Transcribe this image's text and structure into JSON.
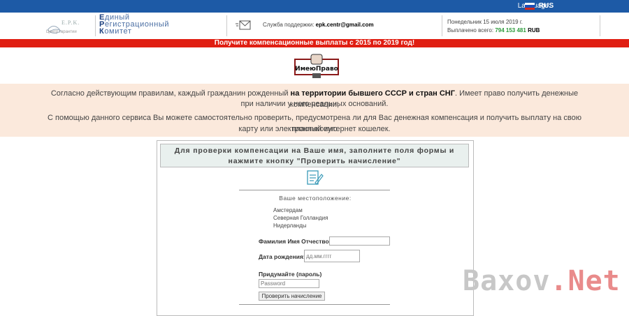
{
  "topbar": {
    "language_label": "Language:",
    "language_value": "RUS",
    "flag_colors": [
      "#ffffff",
      "#1d4fb8",
      "#d52b1e"
    ]
  },
  "header": {
    "logo_text": "E.P.K.",
    "logo_subtitle": "Центр гарантии",
    "org_name": {
      "line1_initial": "Е",
      "line1_rest": "диный",
      "line2_initial": "Р",
      "line2_rest": "егистрационный",
      "line3_initial": "К",
      "line3_rest": "омитет"
    },
    "support_label": "Служба поддержки:",
    "support_email": "epk.centr@gmail.com",
    "date_text": "Понедельник 15 июля 2019 г.",
    "paid_label": "Выплачено всего:",
    "paid_amount": "794 153 481",
    "paid_currency": "RUB"
  },
  "banner": {
    "text": "Получите компенсационные выплаты с 2015 по 2019 год!",
    "color": "#e01e12"
  },
  "emblem": {
    "text": "ИмеюПраво"
  },
  "info": {
    "p1_before": "Согласно действующим правилам, каждый гражданин рожденный ",
    "p1_bold": "на территории бывшего СССР и стран СНГ",
    "p1_after": ". Имеет право получить денежные компенсации,",
    "p1_line2": "при наличии у него реальных оснований.",
    "p2_line1": "С помощью данного сервиса Вы можете самостоятельно проверить, предусмотрена ли для Вас денежная компенсация и получить выплату на свою пластиковую",
    "p2_line2": "карту или электронный интернет кошелек."
  },
  "form": {
    "title_line1": "Для проверки компенсации на Ваше имя, заполните поля формы и",
    "title_line2": "нажмите кнопку \"Проверить начисление\"",
    "location_label": "Ваше местоположение:",
    "location_items": [
      "Амстердам",
      "Северная Голландия",
      "Нидерланды"
    ],
    "name_label": "Фамилия Имя Отчество:",
    "name_value": "",
    "dob_label": "Дата рождения:",
    "dob_placeholder": "дд.мм.гггг",
    "password_label": "Придумайте (пароль)",
    "password_placeholder": "Password",
    "submit_label": "Проверить начисление"
  },
  "watermark": {
    "part1": "Baxov",
    "part2": ".Net"
  }
}
